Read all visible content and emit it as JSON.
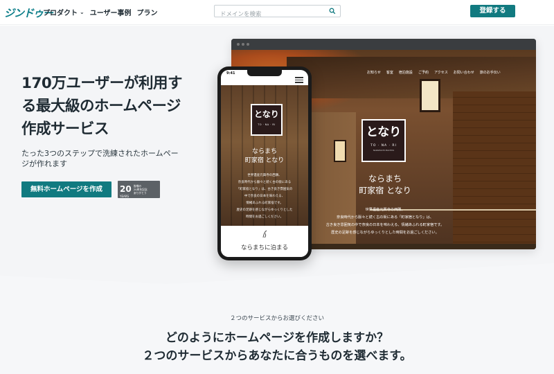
{
  "header": {
    "logo": "ジンドゥー",
    "nav": [
      {
        "label": "プロダクト",
        "has_dropdown": true
      },
      {
        "label": "ユーザー事例",
        "has_dropdown": false
      },
      {
        "label": "プラン",
        "has_dropdown": false
      }
    ],
    "search_placeholder": "ドメインを検索",
    "signup_label": "登録する"
  },
  "hero": {
    "headline": [
      "170万ユーザーが利用す",
      "る最大級のホームページ",
      "作成サービス"
    ],
    "subtext": [
      "たった3つのステップで洗練されたホームペー",
      "ジが作れます"
    ],
    "cta_label": "無料ホームページを作成",
    "badge": {
      "number": "20",
      "unit": "YEARS",
      "text": [
        "皆様の",
        "20周年記念",
        "ありがとう"
      ]
    }
  },
  "mockup": {
    "desktop": {
      "nav": [
        "お知らせ",
        "客室",
        "宿泊施設",
        "ご予約",
        "アクセス",
        "お問い合わせ",
        "旅のお手伝い"
      ],
      "emblem_roman": "TO · NA · RI",
      "emblem_tag": "NARAMACHI MACHIYA",
      "title": [
        "ならまち",
        "町家宿 となり"
      ],
      "body": [
        "世界遺産元興寺の西隣、",
        "奈良時代から脈々と続く古の街にある「町家宿となり」は、",
        "古き良き雰囲気の中で奈良の日本を味わえる、情緒あふれる町家宿です。",
        "歴史の足跡を感じながらゆっくりとした時間をお過ごしください。"
      ]
    },
    "phone": {
      "status": "9:41",
      "emblem_roman": "TO · NA · RI",
      "title": [
        "ならまち",
        "町家宿 となり"
      ],
      "body": [
        "世界遺産元興寺の西隣、",
        "奈良時代から脈々と続く古の街にある",
        "「町家宿となり」は、古き良き雰囲気の",
        "中で奈良の日本を味わえる、",
        "情緒あふれる町家宿です。",
        "歴史の足跡を感じながらゆっくりとした",
        "時間をお過ごしください。"
      ],
      "stay_label": "ならまちに泊まる"
    }
  },
  "services": {
    "kicker": "２つのサービスからお選びください",
    "question": [
      "どのようにホームページを作成しますか？",
      "２つのサービスからあなたに合うものを選べます。"
    ]
  },
  "colors": {
    "accent": "#117a80",
    "text": "#1f2b33",
    "hero_bg": "#f4f5f7"
  }
}
